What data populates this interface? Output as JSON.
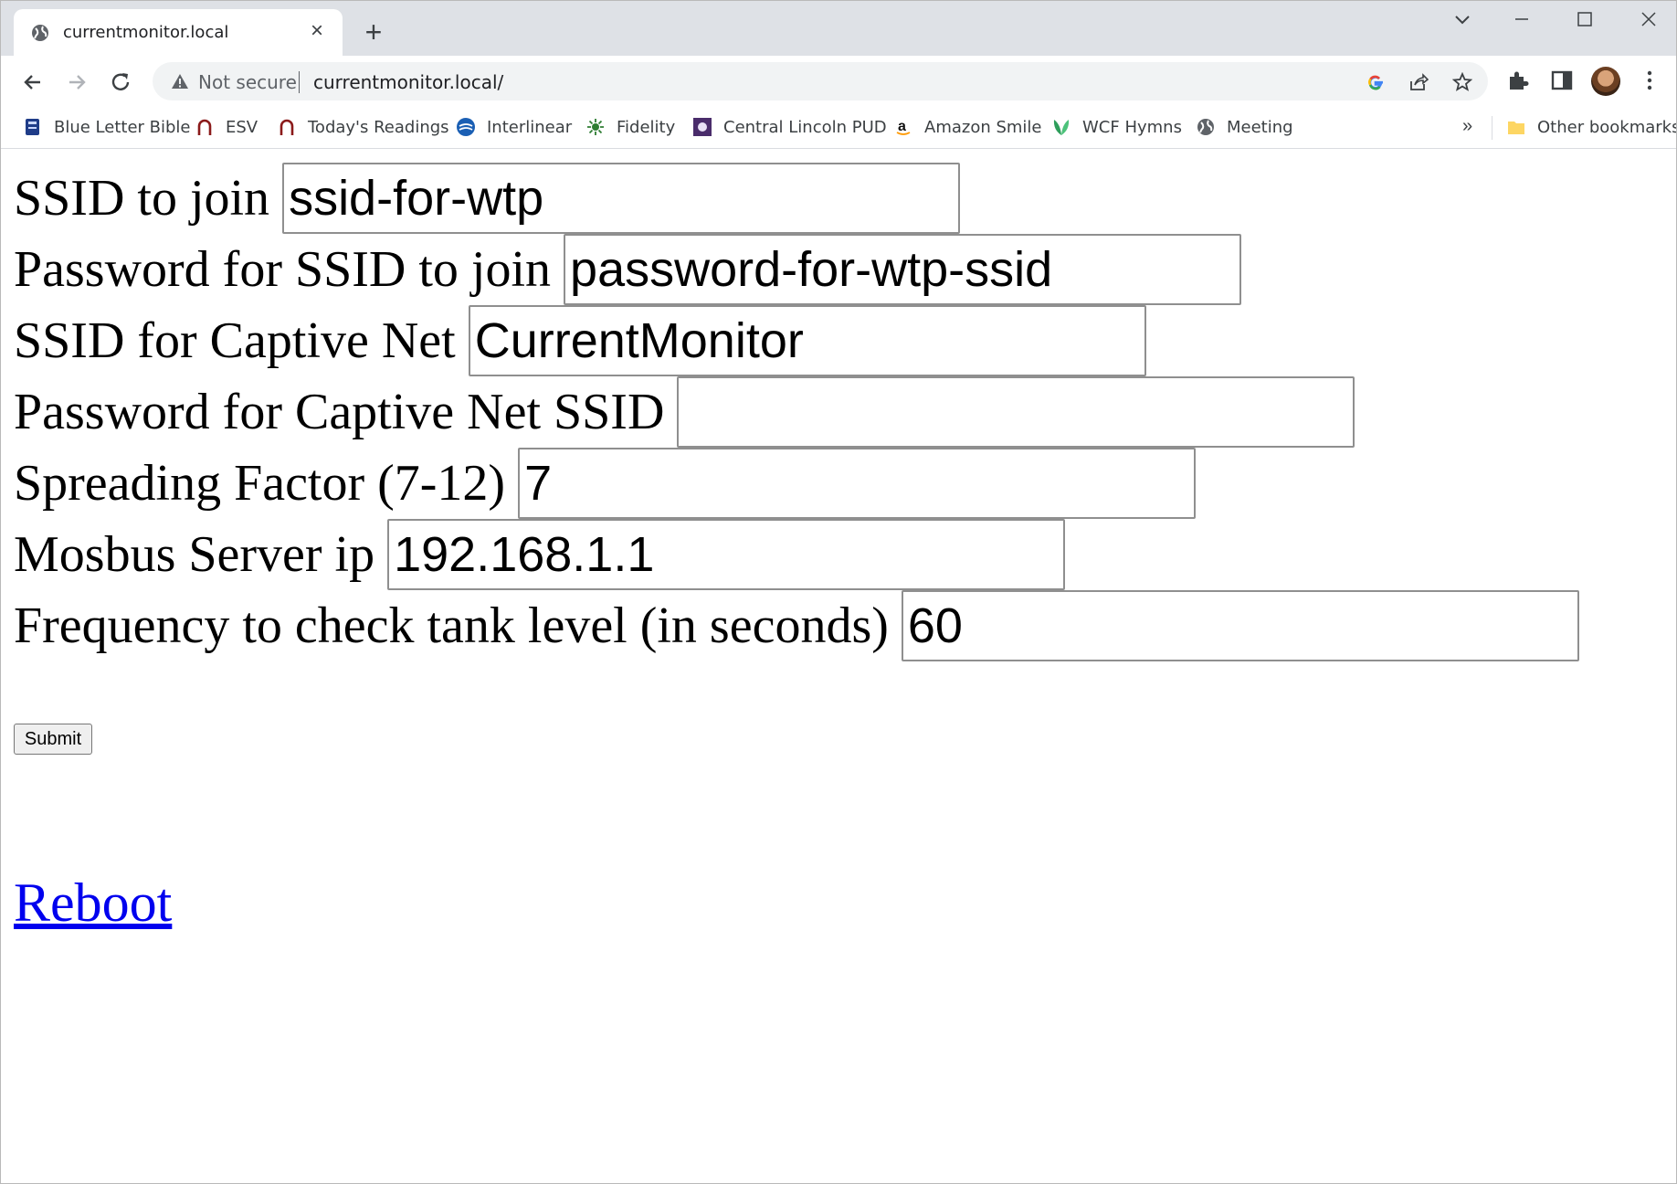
{
  "browser": {
    "tab_title": "currentmonitor.local",
    "tab_close": "×",
    "new_tab": "+",
    "not_secure": "Not secure",
    "url": "currentmonitor.local/",
    "bookmarks": [
      {
        "label": "Blue Letter Bible",
        "icon": "blue-letter-bible-icon"
      },
      {
        "label": "ESV",
        "icon": "esv-icon"
      },
      {
        "label": "Today's Readings",
        "icon": "todays-readings-icon"
      },
      {
        "label": "Interlinear",
        "icon": "interlinear-icon"
      },
      {
        "label": "Fidelity",
        "icon": "fidelity-icon"
      },
      {
        "label": "Central Lincoln PUD",
        "icon": "central-lincoln-pud-icon"
      },
      {
        "label": "Amazon Smile",
        "icon": "amazon-icon"
      },
      {
        "label": "WCF Hymns",
        "icon": "wcf-hymns-icon"
      },
      {
        "label": "Meeting",
        "icon": "globe-icon"
      }
    ],
    "bookmarks_overflow": "»",
    "other_bookmarks": "Other bookmarks"
  },
  "form": {
    "fields": [
      {
        "label": "SSID to join",
        "value": "ssid-for-wtp"
      },
      {
        "label": "Password for SSID to join",
        "value": "password-for-wtp-ssid"
      },
      {
        "label": "SSID for Captive Net",
        "value": "CurrentMonitor"
      },
      {
        "label": "Password for Captive Net SSID",
        "value": ""
      },
      {
        "label": "Spreading Factor (7-12)",
        "value": "7"
      },
      {
        "label": "Mosbus Server ip",
        "value": "192.168.1.1"
      },
      {
        "label": "Frequency to check tank level (in seconds)",
        "value": "60"
      }
    ],
    "submit_label": "Submit"
  },
  "reboot_link": "Reboot"
}
